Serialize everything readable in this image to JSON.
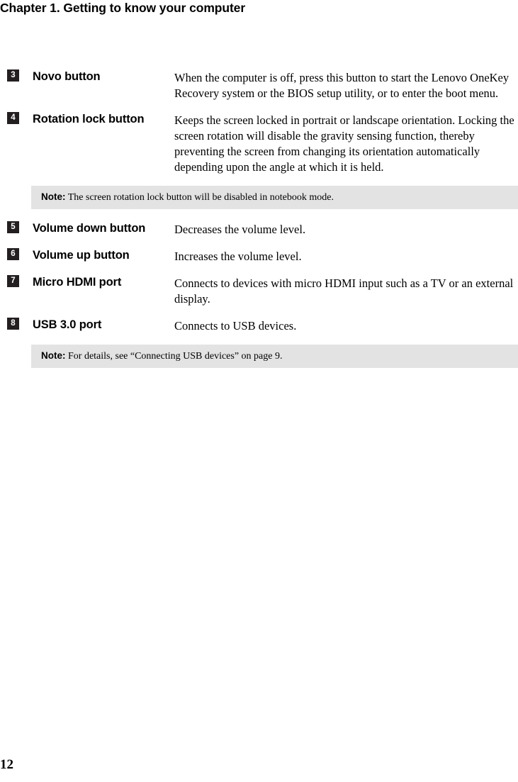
{
  "header": {
    "title": "Chapter 1. Getting to know your computer"
  },
  "footer": {
    "page_number": "12"
  },
  "table": {
    "rows": [
      {
        "kind": "item",
        "number": "3",
        "label": "Novo button",
        "description": "When the computer is off, press this button to start the Lenovo OneKey Recovery system or the BIOS setup utility, or to enter the boot menu."
      },
      {
        "kind": "item",
        "number": "4",
        "label": "Rotation lock button",
        "description": "Keeps the screen locked in portrait or landscape orientation. Locking the screen rotation will disable the gravity sensing function, thereby preventing the screen from changing its orientation automatically depending upon the angle at which it is held."
      },
      {
        "kind": "note",
        "note_word": "Note:",
        "note_text": "The screen rotation lock button will be disabled in notebook mode."
      },
      {
        "kind": "item",
        "number": "5",
        "label": "Volume down button",
        "description": "Decreases the volume level."
      },
      {
        "kind": "item",
        "number": "6",
        "label": "Volume up button",
        "description": "Increases the volume level."
      },
      {
        "kind": "item",
        "number": "7",
        "label": "Micro HDMI port",
        "description": "Connects to devices with micro HDMI input such as a TV or an external display."
      },
      {
        "kind": "item",
        "number": "8",
        "label": "USB 3.0 port",
        "description": "Connects to USB devices."
      },
      {
        "kind": "note",
        "note_word": "Note:",
        "note_text": "For details, see “Connecting USB devices” on page 9."
      }
    ]
  },
  "colors": {
    "badge_background": "#231f20",
    "badge_text": "#ffffff",
    "note_background": "#e3e3e3",
    "body_text": "#000000",
    "page_background": "#ffffff"
  }
}
